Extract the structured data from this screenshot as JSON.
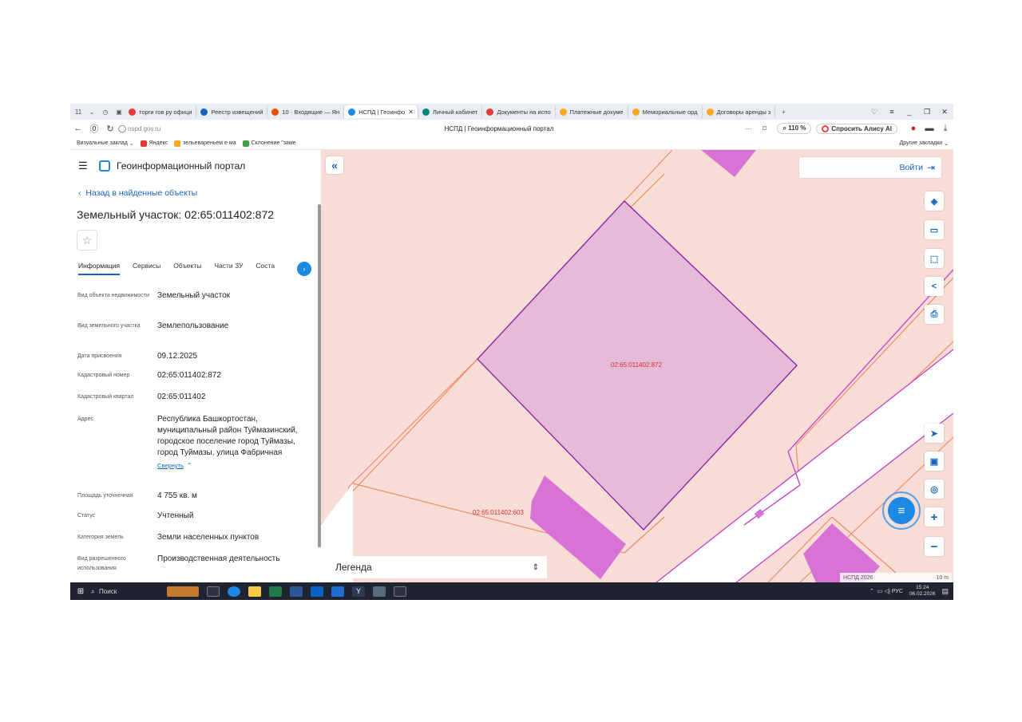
{
  "browser": {
    "tab_count": "11",
    "tabs": [
      {
        "label": "торги гов ру офици",
        "color": "#e53935"
      },
      {
        "label": "Реестр извещений",
        "color": "#1565c0"
      },
      {
        "label": "10 · Входящие — Ян",
        "color": "#e65100"
      },
      {
        "label": "НСПД | Геоинфо",
        "color": "#1e88e5",
        "active": true
      },
      {
        "label": "Личный кабинет",
        "color": "#00897b"
      },
      {
        "label": "Документы на испо",
        "color": "#e53935"
      },
      {
        "label": "Платежные докуме",
        "color": "#f9a825"
      },
      {
        "label": "Мемориальные орд",
        "color": "#f9a825"
      },
      {
        "label": "Договоры аренды з",
        "color": "#f9a825"
      }
    ],
    "url": "nspd.gov.ru",
    "page_title": "НСПД | Геоинформационный портал",
    "zoom": "110 %",
    "alice_label": "Спросить Алису AI",
    "bookmarks": [
      {
        "label": "Визуальные заклад",
        "color": "#ffffff"
      },
      {
        "label": "Яндекс",
        "color": "#e53935"
      },
      {
        "label": "зельевареньем е ма",
        "color": "#f9a825"
      },
      {
        "label": "Склонение \"заме",
        "color": "#43a047"
      }
    ],
    "other_bookmarks": "Другие закладки"
  },
  "panel": {
    "app_title": "Геоинформационный портал",
    "back_link": "Назад в найденные объекты",
    "object_title": "Земельный участок: 02:65:011402:872",
    "tabs": [
      "Информация",
      "Сервисы",
      "Объекты",
      "Части ЗУ",
      "Соста"
    ],
    "fields": [
      {
        "label": "Вид объекта недвижимости",
        "value": "Земельный участок"
      },
      {
        "label": "Вид земельного участка",
        "value": "Землепользование"
      },
      {
        "label": "Дата присвоения",
        "value": "09.12.2025"
      },
      {
        "label": "Кадастровый номер",
        "value": "02:65:011402:872"
      },
      {
        "label": "Кадастровый квартал",
        "value": "02:65:011402"
      },
      {
        "label": "Адрес",
        "value": "Республика Башкортостан, муниципальный район Туймазинский, городское поселение город Туймазы, город Туймазы, улица Фабричная"
      },
      {
        "label": "Площадь уточненная",
        "value": "4 755 кв. м"
      },
      {
        "label": "Статус",
        "value": "Учтенный"
      },
      {
        "label": "Категория земель",
        "value": "Земли населенных пунктов"
      },
      {
        "label": "Вид разрешенного использования",
        "value": "Производственная деятельность"
      }
    ],
    "collapse_label": "Свернуть"
  },
  "map": {
    "login_label": "Войти",
    "main_parcel_label": "02:65:011402:872",
    "neighbor_parcel_label": "02:65:011402:603",
    "legend_label": "Легенда",
    "credit": "НСПД 2026",
    "scale": "10 m",
    "colors": {
      "background": "#f8ddd6",
      "parcel_fill": "#e6bbd8",
      "parcel_stroke": "#8e24aa",
      "building": "#d873d6",
      "boundary": "#f28a6a"
    }
  },
  "taskbar": {
    "search_label": "Поиск",
    "lang": "РУС",
    "time": "15:24",
    "date": "06.02.2026"
  }
}
